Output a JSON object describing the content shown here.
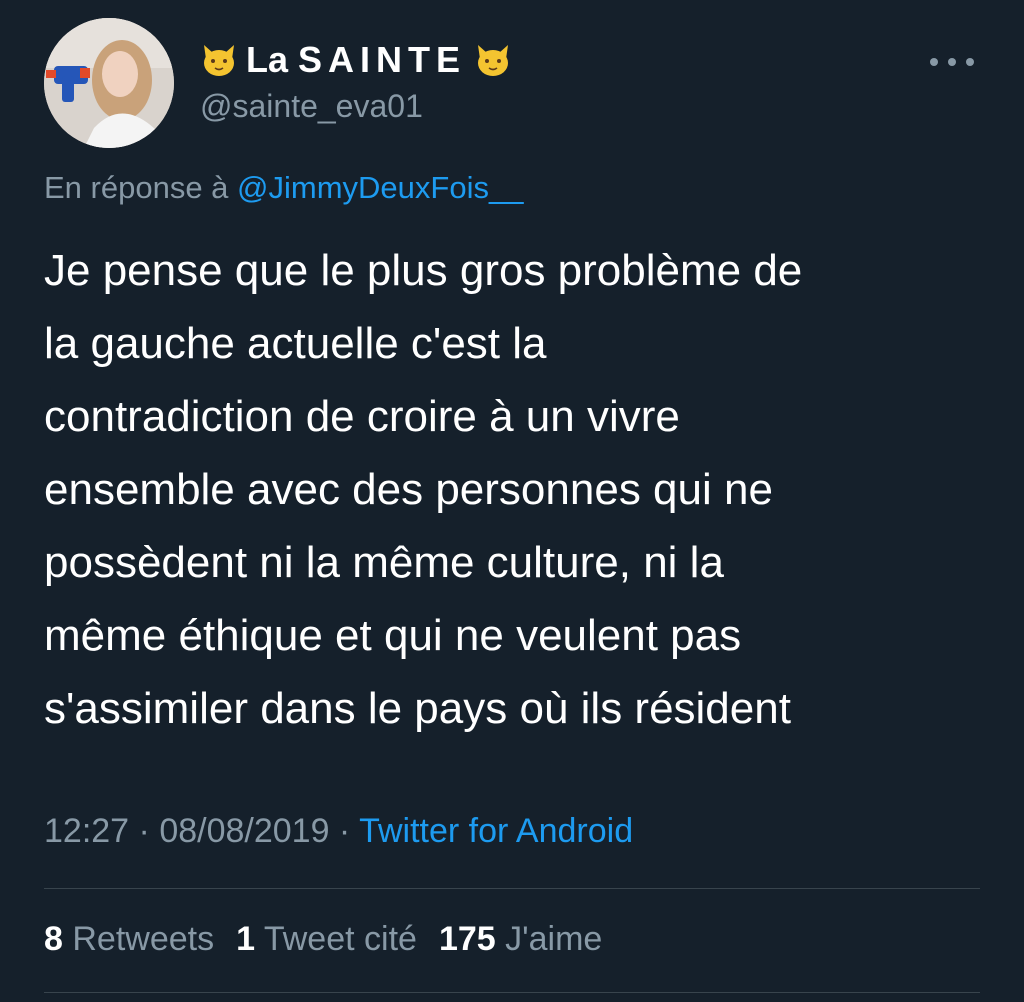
{
  "user": {
    "display_name_prefix": "La",
    "display_name_caps": "SAINTE",
    "handle": "@sainte_eva01",
    "name_emoji_icon": "cat-face-icon"
  },
  "reply": {
    "prefix": "En réponse à ",
    "mention": "@JimmyDeuxFois__"
  },
  "tweet": {
    "lines": [
      "Je pense que le plus gros problème de",
      "la gauche actuelle c'est la",
      "contradiction de croire à un vivre",
      "ensemble avec des personnes qui ne",
      "possèdent ni la même culture, ni la",
      "même éthique et qui ne veulent pas",
      "s'assimiler dans le pays où ils résident"
    ]
  },
  "meta": {
    "time": "12:27",
    "separator": " · ",
    "date": "08/08/2019",
    "source": "Twitter for Android"
  },
  "stats": {
    "retweets_count": "8",
    "retweets_label": " Retweets",
    "quotes_count": "1",
    "quotes_label": " Tweet cité",
    "likes_count": "175",
    "likes_label": " J'aime"
  },
  "colors": {
    "background": "#15202b",
    "text": "#ffffff",
    "muted": "#8899a6",
    "link": "#1d9bf0",
    "divider": "#38444d"
  }
}
